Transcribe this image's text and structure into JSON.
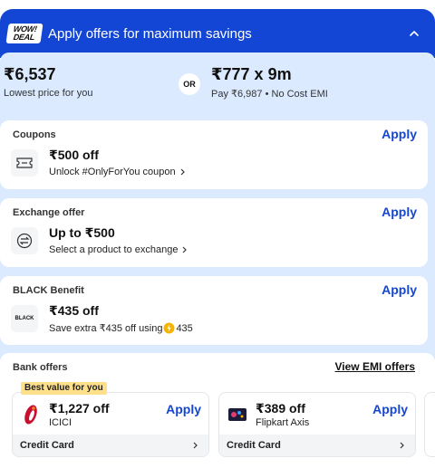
{
  "header": {
    "badge_line1": "WOW!",
    "badge_line2": "DEAL",
    "title": "Apply offers for maximum savings"
  },
  "pricing": {
    "lowest_price": "₹6,537",
    "lowest_label": "Lowest price for you",
    "or_label": "OR",
    "emi_price": "₹777 x 9m",
    "emi_label": "Pay ₹6,987 • No Cost EMI"
  },
  "coupons": {
    "title": "Coupons",
    "apply": "Apply",
    "offer": "₹500 off",
    "detail": "Unlock #OnlyForYou coupon"
  },
  "exchange": {
    "title": "Exchange offer",
    "apply": "Apply",
    "offer": "Up to ₹500",
    "detail": "Select a product to exchange"
  },
  "black": {
    "title": "BLACK Benefit",
    "apply": "Apply",
    "logo_text": "BLACK",
    "offer": "₹435 off",
    "detail": "Save extra ₹435 off using",
    "coins": "435"
  },
  "bank": {
    "title": "Bank offers",
    "view_emi": "View EMI offers",
    "best_badge": "Best value for you",
    "tiles": [
      {
        "amount": "₹1,227 off",
        "bank": "ICICI",
        "apply": "Apply",
        "type": "Credit Card"
      },
      {
        "amount": "₹389 off",
        "bank": "Flipkart Axis",
        "apply": "Apply",
        "type": "Credit Card"
      }
    ]
  },
  "colors": {
    "accent": "#1446d6",
    "panel": "#dbeaff",
    "badge": "#ffe08a"
  }
}
